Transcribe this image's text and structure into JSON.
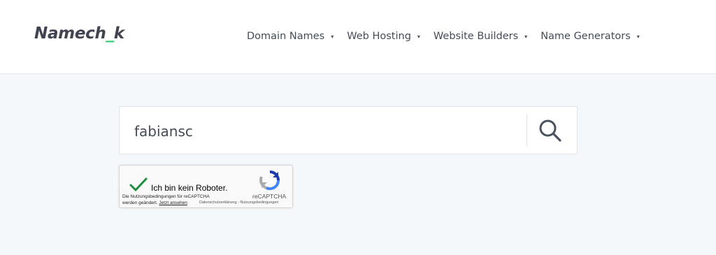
{
  "brand": {
    "logo_part1": "Namech",
    "logo_part2": "_",
    "logo_part3": "k",
    "accent_color": "#2ecc71"
  },
  "nav": {
    "items": [
      {
        "label": "Domain Names",
        "caret": "▾"
      },
      {
        "label": "Web Hosting",
        "caret": "▾"
      },
      {
        "label": "Website Builders",
        "caret": "▾"
      },
      {
        "label": "Name Generators",
        "caret": "▾"
      }
    ]
  },
  "search": {
    "value": "fabiansc",
    "icon": "search-icon"
  },
  "recaptcha": {
    "label": "Ich bin kein Roboter.",
    "brand": "reCAPTCHA",
    "terms_line1": "Die Nutzungsbedingungen für reCAPTCHA",
    "terms_line2": "werden geändert.",
    "terms_link": "Jetzt ansehen",
    "privacy": "Datenschutzerklärung",
    "separator": " - ",
    "terms": "Nutzungsbedingungen",
    "checked": true,
    "check_color": "#1e8e3e"
  }
}
